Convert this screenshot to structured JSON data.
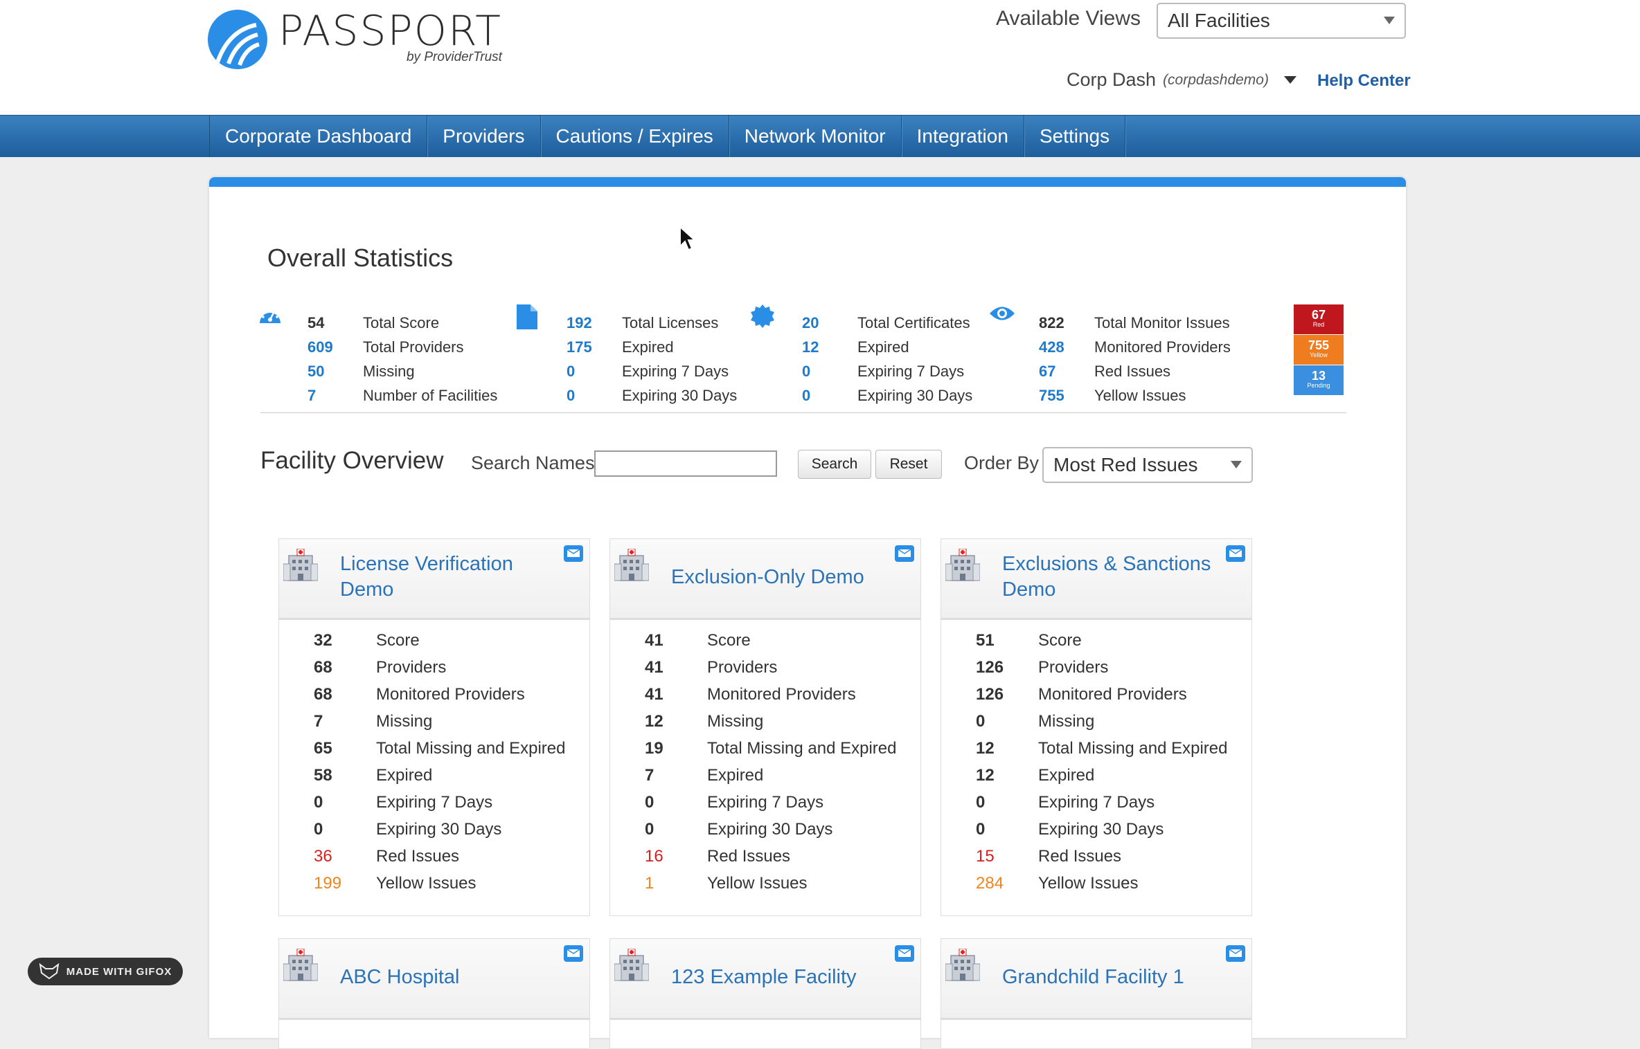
{
  "brand": {
    "name": "PASSPORT",
    "byline": "by ProviderTrust"
  },
  "header": {
    "views_label": "Available Views",
    "views_value": "All Facilities",
    "user_name": "Corp Dash",
    "user_account": "(corpdashdemo)",
    "help_label": "Help Center"
  },
  "nav": {
    "items": [
      {
        "label": "Corporate Dashboard"
      },
      {
        "label": "Providers"
      },
      {
        "label": "Cautions / Expires"
      },
      {
        "label": "Network Monitor"
      },
      {
        "label": "Integration"
      },
      {
        "label": "Settings"
      }
    ]
  },
  "overall": {
    "title": "Overall Statistics",
    "score": {
      "icon": "speedometer-icon",
      "rows": [
        {
          "value": "54",
          "label": "Total Score"
        },
        {
          "value": "609",
          "label": "Total Providers"
        },
        {
          "value": "50",
          "label": "Missing"
        },
        {
          "value": "7",
          "label": "Number of Facilities"
        }
      ]
    },
    "licenses": {
      "icon": "document-icon",
      "rows": [
        {
          "value": "192",
          "label": "Total Licenses"
        },
        {
          "value": "175",
          "label": "Expired"
        },
        {
          "value": "0",
          "label": "Expiring 7 Days"
        },
        {
          "value": "0",
          "label": "Expiring 30 Days"
        }
      ]
    },
    "certificates": {
      "icon": "certificate-seal-icon",
      "rows": [
        {
          "value": "20",
          "label": "Total Certificates"
        },
        {
          "value": "12",
          "label": "Expired"
        },
        {
          "value": "0",
          "label": "Expiring 7 Days"
        },
        {
          "value": "0",
          "label": "Expiring 30 Days"
        }
      ]
    },
    "monitor": {
      "icon": "eye-icon",
      "rows": [
        {
          "value": "822",
          "label": "Total Monitor Issues"
        },
        {
          "value": "428",
          "label": "Monitored Providers"
        },
        {
          "value": "67",
          "label": "Red Issues"
        },
        {
          "value": "755",
          "label": "Yellow Issues"
        }
      ]
    },
    "badges": [
      {
        "value": "67",
        "label": "Red",
        "color": "#c0161e"
      },
      {
        "value": "755",
        "label": "Yellow",
        "color": "#ef7d1f"
      },
      {
        "value": "13",
        "label": "Pending",
        "color": "#3a8fe0"
      }
    ]
  },
  "facility_overview": {
    "title": "Facility Overview",
    "search_label": "Search Names",
    "search_value": "",
    "search_button": "Search",
    "reset_button": "Reset",
    "order_label": "Order By",
    "order_value": "Most Red Issues"
  },
  "facilities": [
    {
      "name": "License Verification Demo",
      "stats": [
        {
          "value": "32",
          "label": "Score"
        },
        {
          "value": "68",
          "label": "Providers"
        },
        {
          "value": "68",
          "label": "Monitored Providers"
        },
        {
          "value": "7",
          "label": "Missing"
        },
        {
          "value": "65",
          "label": "Total Missing and Expired"
        },
        {
          "value": "58",
          "label": "Expired"
        },
        {
          "value": "0",
          "label": "Expiring 7 Days"
        },
        {
          "value": "0",
          "label": "Expiring 30 Days"
        },
        {
          "value": "36",
          "label": "Red Issues"
        },
        {
          "value": "199",
          "label": "Yellow Issues"
        }
      ]
    },
    {
      "name": "Exclusion-Only Demo",
      "stats": [
        {
          "value": "41",
          "label": "Score"
        },
        {
          "value": "41",
          "label": "Providers"
        },
        {
          "value": "41",
          "label": "Monitored Providers"
        },
        {
          "value": "12",
          "label": "Missing"
        },
        {
          "value": "19",
          "label": "Total Missing and Expired"
        },
        {
          "value": "7",
          "label": "Expired"
        },
        {
          "value": "0",
          "label": "Expiring 7 Days"
        },
        {
          "value": "0",
          "label": "Expiring 30 Days"
        },
        {
          "value": "16",
          "label": "Red Issues"
        },
        {
          "value": "1",
          "label": "Yellow Issues"
        }
      ]
    },
    {
      "name": "Exclusions & Sanctions Demo",
      "stats": [
        {
          "value": "51",
          "label": "Score"
        },
        {
          "value": "126",
          "label": "Providers"
        },
        {
          "value": "126",
          "label": "Monitored Providers"
        },
        {
          "value": "0",
          "label": "Missing"
        },
        {
          "value": "12",
          "label": "Total Missing and Expired"
        },
        {
          "value": "12",
          "label": "Expired"
        },
        {
          "value": "0",
          "label": "Expiring 7 Days"
        },
        {
          "value": "0",
          "label": "Expiring 30 Days"
        },
        {
          "value": "15",
          "label": "Red Issues"
        },
        {
          "value": "284",
          "label": "Yellow Issues"
        }
      ]
    },
    {
      "name": "ABC Hospital",
      "stats": []
    },
    {
      "name": "123 Example Facility",
      "stats": []
    },
    {
      "name": "Grandchild Facility 1",
      "stats": []
    }
  ],
  "colors": {
    "red_issues": "#d61f1f",
    "yellow_issues": "#f0841c",
    "accent": "#2b8ee6",
    "link": "#2a73b8"
  },
  "watermark": {
    "label": "MADE WITH GIFOX"
  }
}
